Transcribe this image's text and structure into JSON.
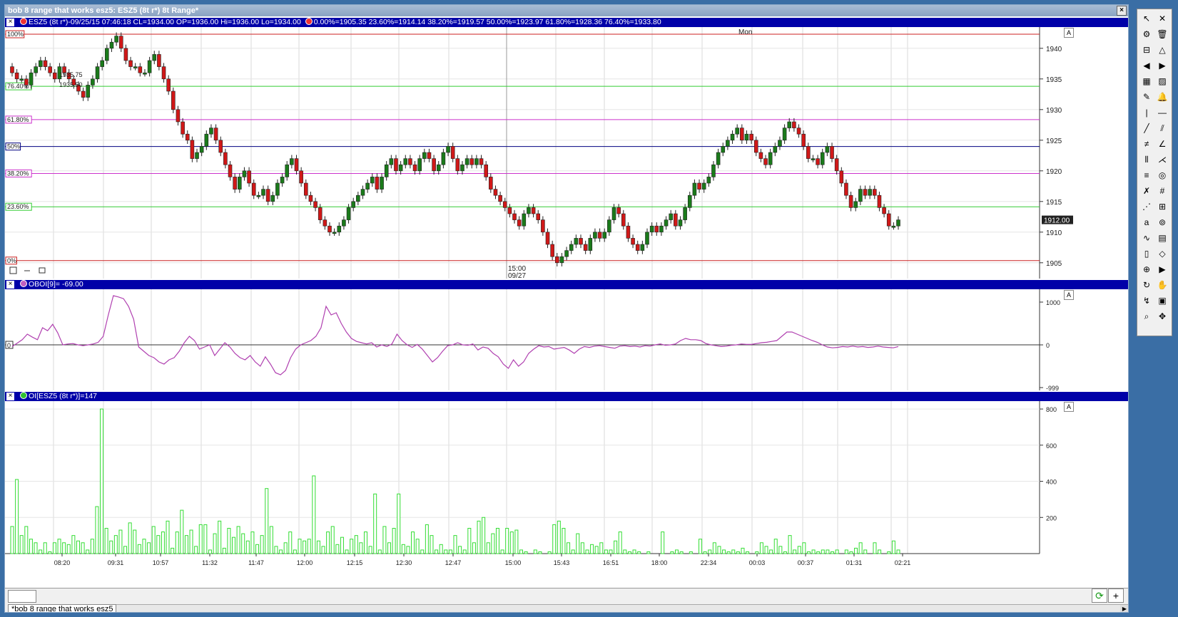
{
  "window": {
    "title": "bob 8 range that works esz5: ESZ5 (8t r*) 8t Range*",
    "close_glyph": "×"
  },
  "price_pane": {
    "header_left": "ESZ5 (8t r*)-09/25/15 07:46:18 CL=1934.00 OP=1936.00 Hi=1936.00 Lo=1934.00",
    "header_right": "0.00%=1905.35 23.60%=1914.14 38.20%=1919.57 50.00%=1923.97 61.80%=1928.36 76.40%=1933.80",
    "day_label": "Mon",
    "session_label": [
      "15:00",
      "09/27"
    ],
    "last_price": "1912.00",
    "price_note": [
      "1935.75",
      "1935.50"
    ],
    "autoscale": "A"
  },
  "oboi_pane": {
    "header": "OBOI[9]=  -69.00",
    "zero_label": "0",
    "autoscale": "A"
  },
  "oi_pane": {
    "header": "OI[ESZ5 (8t r*)]=147",
    "autoscale": "A"
  },
  "bottom": {
    "tab_label": "*bob 8 range that works esz5",
    "refresh": "⟳",
    "plus": "+"
  },
  "colors": {
    "up": "#1a7a1a",
    "down": "#d01818",
    "fib_green": "#33cc33",
    "fib_magenta": "#cc33cc",
    "fib_navy": "#000080",
    "fib_red": "#cc2222",
    "oboi": "#b040b0",
    "oi": "#33dd33"
  },
  "chart_data": [
    {
      "type": "candlestick",
      "title": "ESZ5 (8t r*) 8t Range",
      "ylim": [
        1903,
        1943
      ],
      "yticks": [
        1905,
        1910,
        1915,
        1920,
        1925,
        1930,
        1935,
        1940
      ],
      "x_ticks": [
        "08:20",
        "09:31",
        "10:57",
        "11:32",
        "11:47",
        "12:00",
        "12:15",
        "12:30",
        "12:47",
        "15:00",
        "15:43",
        "16:51",
        "18:00",
        "22:34",
        "00:03",
        "00:37",
        "01:31",
        "02:21"
      ],
      "fib_levels": [
        {
          "label": "100%",
          "value": 1942.3,
          "color": "#cc2222"
        },
        {
          "label": "76.40%",
          "value": 1933.8,
          "color": "#33cc33"
        },
        {
          "label": "61.80%",
          "value": 1928.36,
          "color": "#cc33cc"
        },
        {
          "label": "50%",
          "value": 1923.97,
          "color": "#000080"
        },
        {
          "label": "38.20%",
          "value": 1919.57,
          "color": "#cc33cc"
        },
        {
          "label": "23.60%",
          "value": 1914.14,
          "color": "#33cc33"
        },
        {
          "label": "0%",
          "value": 1905.35,
          "color": "#cc2222"
        }
      ],
      "close": [
        1936,
        1935,
        1935,
        1934,
        1936,
        1937,
        1938,
        1937,
        1936,
        1935,
        1937,
        1936,
        1935,
        1934,
        1933,
        1932,
        1934,
        1935,
        1937,
        1938,
        1940,
        1941,
        1942,
        1940,
        1938,
        1937,
        1937,
        1936,
        1936,
        1938,
        1939,
        1937,
        1935,
        1933,
        1930,
        1928,
        1926,
        1925,
        1922,
        1923,
        1924,
        1926,
        1927,
        1925,
        1923,
        1921,
        1919,
        1917,
        1919,
        1920,
        1918,
        1916,
        1916,
        1917,
        1915,
        1916,
        1918,
        1919,
        1921,
        1922,
        1920,
        1918,
        1916,
        1915,
        1914,
        1912,
        1911,
        1910,
        1910,
        1911,
        1912,
        1914,
        1915,
        1916,
        1917,
        1918,
        1919,
        1917,
        1919,
        1921,
        1922,
        1920,
        1921,
        1922,
        1921,
        1920,
        1922,
        1923,
        1922,
        1920,
        1921,
        1923,
        1924,
        1922,
        1920,
        1921,
        1922,
        1921,
        1922,
        1921,
        1919,
        1917,
        1916,
        1915,
        1914,
        1913,
        1912,
        1911,
        1913,
        1914,
        1913,
        1912,
        1910,
        1908,
        1906,
        1905,
        1906,
        1907,
        1908,
        1909,
        1908,
        1907,
        1909,
        1910,
        1909,
        1910,
        1912,
        1914,
        1913,
        1911,
        1909,
        1908,
        1907,
        1908,
        1910,
        1911,
        1910,
        1911,
        1912,
        1913,
        1911,
        1912,
        1914,
        1916,
        1918,
        1917,
        1918,
        1919,
        1921,
        1923,
        1924,
        1925,
        1926,
        1927,
        1925,
        1926,
        1925,
        1923,
        1922,
        1921,
        1923,
        1924,
        1925,
        1927,
        1928,
        1927,
        1926,
        1924,
        1922,
        1922,
        1921,
        1923,
        1924,
        1922,
        1920,
        1918,
        1916,
        1914,
        1915,
        1917,
        1916,
        1917,
        1916,
        1914,
        1913,
        1911,
        1911,
        1912
      ],
      "oboi": [
        -40,
        40,
        120,
        250,
        180,
        120,
        400,
        330,
        480,
        280,
        0,
        20,
        30,
        0,
        -20,
        0,
        20,
        60,
        200,
        700,
        1150,
        1120,
        1080,
        900,
        600,
        -50,
        -150,
        -250,
        -300,
        -400,
        -450,
        -350,
        -300,
        -150,
        50,
        200,
        100,
        -100,
        -50,
        0,
        -250,
        -100,
        50,
        -50,
        -200,
        -300,
        -350,
        -250,
        -400,
        -500,
        -280,
        -450,
        -650,
        -700,
        -600,
        -300,
        -100,
        0,
        50,
        100,
        200,
        400,
        900,
        700,
        750,
        500,
        300,
        150,
        80,
        50,
        20,
        50,
        -50,
        0,
        -40,
        20,
        250,
        100,
        0,
        -60,
        10,
        -100,
        -250,
        -400,
        -300,
        -150,
        -20,
        0,
        50,
        0,
        -10,
        20,
        -120,
        -50,
        -80,
        -200,
        -280,
        -450,
        -550,
        -350,
        -500,
        -400,
        -200,
        -100,
        -20,
        -50,
        -40,
        -100,
        -80,
        -60,
        -120,
        -200,
        -100,
        -40,
        -60,
        -30,
        -20,
        -40,
        -60,
        -80,
        -30,
        -20,
        -40,
        -30,
        -50,
        -20,
        -30,
        0,
        20,
        -10,
        0,
        20,
        100,
        150,
        120,
        120,
        100,
        30,
        0,
        -20,
        -40,
        -30,
        -10,
        0,
        20,
        10,
        10,
        30,
        50,
        60,
        80,
        100,
        200,
        300,
        300,
        250,
        200,
        150,
        100,
        60,
        0,
        -50,
        -70,
        -60,
        -40,
        -50,
        -30,
        -50,
        -40,
        -60,
        -50,
        -30,
        -50,
        -60,
        -69,
        -40
      ],
      "oi": [
        150,
        410,
        100,
        150,
        80,
        60,
        20,
        60,
        10,
        60,
        80,
        60,
        50,
        100,
        70,
        60,
        20,
        80,
        260,
        800,
        140,
        70,
        100,
        130,
        40,
        170,
        130,
        50,
        80,
        60,
        150,
        100,
        120,
        180,
        30,
        120,
        240,
        100,
        130,
        40,
        160,
        160,
        20,
        110,
        180,
        30,
        140,
        90,
        150,
        110,
        70,
        120,
        50,
        100,
        360,
        150,
        40,
        20,
        60,
        120,
        20,
        80,
        70,
        80,
        430,
        70,
        40,
        120,
        150,
        50,
        90,
        20,
        80,
        100,
        60,
        120,
        40,
        330,
        20,
        150,
        60,
        140,
        330,
        50,
        40,
        120,
        80,
        20,
        160,
        100,
        20,
        50,
        20,
        20,
        100,
        40,
        20,
        140,
        60,
        180,
        200,
        60,
        110,
        140,
        20,
        140,
        120,
        130,
        20,
        10,
        0,
        20,
        10,
        0,
        10,
        160,
        180,
        140,
        60,
        20,
        110,
        60,
        20,
        50,
        40,
        60,
        20,
        20,
        70,
        120,
        20,
        10,
        20,
        10,
        0,
        10,
        0,
        0,
        120,
        0,
        10,
        20,
        10,
        0,
        10,
        0,
        80,
        10,
        20,
        60,
        40,
        20,
        10,
        20,
        10,
        30,
        10,
        0,
        10,
        60,
        40,
        20,
        80,
        40,
        10,
        100,
        20,
        40,
        60,
        10,
        20,
        10,
        20,
        20,
        10,
        20,
        0,
        20,
        10,
        30,
        60,
        20,
        0,
        60,
        20,
        0,
        10,
        70,
        20
      ]
    }
  ]
}
